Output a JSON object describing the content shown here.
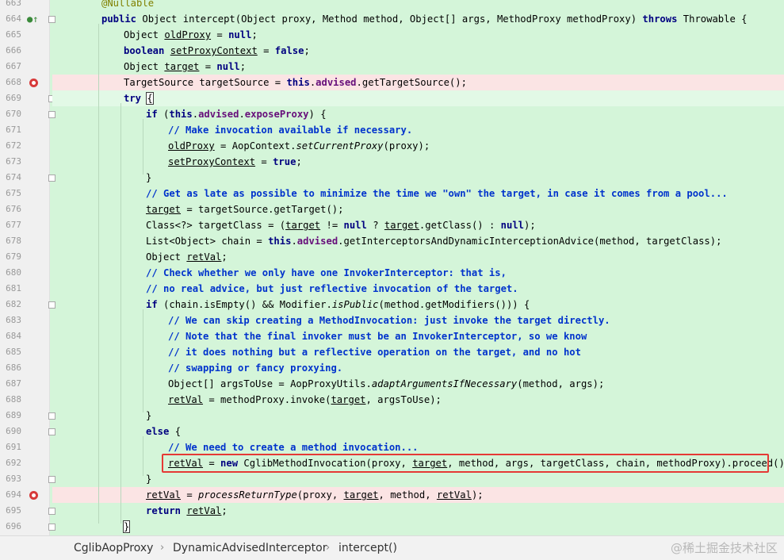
{
  "editor": {
    "lines": [
      {
        "n": "663",
        "html": "<span class='ann'>@Nullable</span>",
        "indent": 128
      },
      {
        "n": "664",
        "html": "<span class='kw'>public</span> Object intercept(Object proxy, Method method, Object[] args, MethodProxy methodProxy) <span class='kw'>throws</span> Throwable {",
        "indent": 128
      },
      {
        "n": "665",
        "html": "Object <span class='ul'>oldProxy</span> = <span class='kw'>null</span>;",
        "indent": 156
      },
      {
        "n": "666",
        "html": "<span class='kw'>boolean</span> <span class='ul'>setProxyContext</span> = <span class='kw'>false</span>;",
        "indent": 156
      },
      {
        "n": "667",
        "html": "Object <span class='ul'>target</span> = <span class='kw'>null</span>;",
        "indent": 156
      },
      {
        "n": "668",
        "html": "TargetSource targetSource = <span class='kw'>this</span>.<span class='fld'>advised</span>.getTargetSource();",
        "indent": 156
      },
      {
        "n": "669",
        "html": "<span class='kw'>try</span> <span class='cursor-bracket'>{</span>",
        "indent": 156
      },
      {
        "n": "670",
        "html": "<span class='kw'>if</span> (<span class='kw'>this</span>.<span class='fld'>advised</span>.<span class='fld'>exposeProxy</span>) {",
        "indent": 184
      },
      {
        "n": "671",
        "html": "<span class='cm'>// Make invocation available if necessary.</span>",
        "indent": 212
      },
      {
        "n": "672",
        "html": "<span class='ul'>oldProxy</span> = AopContext.<span class='it'>setCurrentProxy</span>(proxy);",
        "indent": 212
      },
      {
        "n": "673",
        "html": "<span class='ul'>setProxyContext</span> = <span class='kw'>true</span>;",
        "indent": 212
      },
      {
        "n": "674",
        "html": "}",
        "indent": 184
      },
      {
        "n": "675",
        "html": "<span class='cm'>// Get as late as possible to minimize the time we \"own\" the target, in case it comes from a pool...</span>",
        "indent": 184
      },
      {
        "n": "676",
        "html": "<span class='ul'>target</span> = targetSource.getTarget();",
        "indent": 184
      },
      {
        "n": "677",
        "html": "Class&lt;?&gt; targetClass = (<span class='ul'>target</span> != <span class='kw'>null</span> ? <span class='ul'>target</span>.getClass() : <span class='kw'>null</span>);",
        "indent": 184
      },
      {
        "n": "678",
        "html": "List&lt;Object&gt; chain = <span class='kw'>this</span>.<span class='fld'>advised</span>.getInterceptorsAndDynamicInterceptionAdvice(method, targetClass);",
        "indent": 184
      },
      {
        "n": "679",
        "html": "Object <span class='ul'>retVal</span>;",
        "indent": 184
      },
      {
        "n": "680",
        "html": "<span class='cm'>// Check whether we only have one InvokerInterceptor: that is,</span>",
        "indent": 184
      },
      {
        "n": "681",
        "html": "<span class='cm'>// no real advice, but just reflective invocation of the target.</span>",
        "indent": 184
      },
      {
        "n": "682",
        "html": "<span class='kw'>if</span> (chain.isEmpty() &amp;&amp; Modifier.<span class='it'>isPublic</span>(method.getModifiers())) {",
        "indent": 184
      },
      {
        "n": "683",
        "html": "<span class='cm'>// We can skip creating a MethodInvocation: just invoke the target directly.</span>",
        "indent": 212
      },
      {
        "n": "684",
        "html": "<span class='cm'>// Note that the final invoker must be an InvokerInterceptor, so we know</span>",
        "indent": 212
      },
      {
        "n": "685",
        "html": "<span class='cm'>// it does nothing but a reflective operation on the target, and no hot</span>",
        "indent": 212
      },
      {
        "n": "686",
        "html": "<span class='cm'>// swapping or fancy proxying.</span>",
        "indent": 212
      },
      {
        "n": "687",
        "html": "Object[] argsToUse = AopProxyUtils.<span class='it'>adaptArgumentsIfNecessary</span>(method, args);",
        "indent": 212
      },
      {
        "n": "688",
        "html": "<span class='ul'>retVal</span> = methodProxy.invoke(<span class='ul'>target</span>, argsToUse);",
        "indent": 212
      },
      {
        "n": "689",
        "html": "}",
        "indent": 184
      },
      {
        "n": "690",
        "html": "<span class='kw'>else</span> {",
        "indent": 184
      },
      {
        "n": "691",
        "html": "<span class='cm'>// We need to create a method invocation...</span>",
        "indent": 212
      },
      {
        "n": "692",
        "html": "<span class='ul'>retVal</span> = <span class='kw'>new</span> CglibMethodInvocation(proxy, <span class='ul'>target</span>, method, args, targetClass, chain, methodProxy).proceed();",
        "indent": 212
      },
      {
        "n": "693",
        "html": "}",
        "indent": 184
      },
      {
        "n": "694",
        "html": "<span class='ul'>retVal</span> = <span class='it'>processReturnType</span>(proxy, <span class='ul'>target</span>, method, <span class='ul'>retVal</span>);",
        "indent": 184
      },
      {
        "n": "695",
        "html": "<span class='kw'>return</span> <span class='ul'>retVal</span>;",
        "indent": 184
      },
      {
        "n": "696",
        "html": "<span class='cursor-bracket'>}</span>",
        "indent": 156
      }
    ]
  },
  "breadcrumb": {
    "items": [
      "CglibAopProxy",
      "DynamicAdvisedInterceptor",
      "intercept()"
    ],
    "separator": "›"
  },
  "watermark": "@稀土掘金技术社区"
}
